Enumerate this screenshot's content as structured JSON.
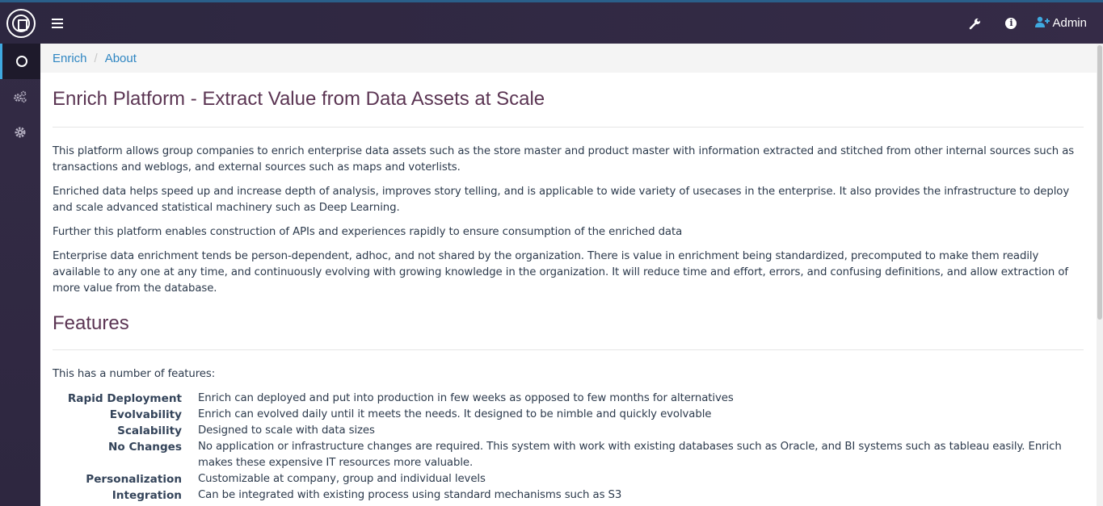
{
  "topbar": {
    "admin_label": "Admin",
    "icons": [
      "logo-icon",
      "hamburger-menu-icon",
      "wrench-icon",
      "info-icon",
      "user-add-icon"
    ]
  },
  "sidebar": {
    "items": [
      {
        "icon": "circle-icon",
        "active": true
      },
      {
        "icon": "cogs-icon",
        "active": false
      },
      {
        "icon": "gear-icon",
        "active": false
      }
    ]
  },
  "breadcrumb": {
    "items": [
      "Enrich",
      "About"
    ],
    "separator": "/"
  },
  "main": {
    "title": "Enrich Platform - Extract Value from Data Assets at Scale",
    "paragraphs": [
      "This platform allows group companies to enrich enterprise data assets such as the store master and product master with information extracted and stitched from other internal sources such as transactions and weblogs, and external sources such as maps and voterlists.",
      "Enriched data helps speed up and increase depth of analysis, improves story telling, and is applicable to wide variety of usecases in the enterprise. It also provides the infrastructure to deploy and scale advanced statistical machinery such as Deep Learning.",
      "Further this platform enables construction of APIs and experiences rapidly to ensure consumption of the enriched data",
      "Enterprise data enrichment tends be person-dependent, adhoc, and not shared by the organization. There is value in enrichment being standardized, precomputed to make them readily available to any one at any time, and continuously evolving with growing knowledge in the organization. It will reduce time and effort, errors, and confusing definitions, and allow extraction of more value from the database."
    ],
    "features_title": "Features",
    "features_intro": "This has a number of features:",
    "features": [
      {
        "term": "Rapid Deployment",
        "desc": "Enrich can deployed and put into production in few weeks as opposed to few months for alternatives"
      },
      {
        "term": "Evolvability",
        "desc": "Enrich can evolved daily until it meets the needs. It designed to be nimble and quickly evolvable"
      },
      {
        "term": "Scalability",
        "desc": "Designed to scale with data sizes"
      },
      {
        "term": "No Changes",
        "desc": "No application or infrastructure changes are required. This system with work with existing databases such as Oracle, and BI systems such as tableau easily. Enrich makes these expensive IT resources more valuable."
      },
      {
        "term": "Personalization",
        "desc": "Customizable at company, group and individual levels"
      },
      {
        "term": "Integration",
        "desc": "Can be integrated with existing process using standard mechanisms such as S3"
      }
    ]
  },
  "colors": {
    "topbar": "#2f2843",
    "sidebar": "#302840",
    "accent": "#2f86c2",
    "heading": "#5b3553"
  }
}
